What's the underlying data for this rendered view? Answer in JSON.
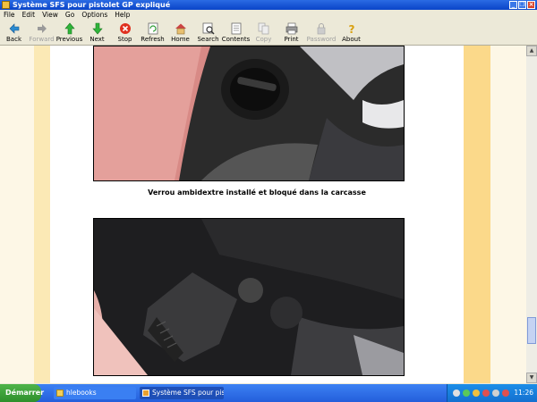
{
  "window": {
    "title": "Système SFS pour pistolet GP expliqué",
    "buttons": [
      "_",
      "❐",
      "×"
    ]
  },
  "menu": [
    "File",
    "Edit",
    "View",
    "Go",
    "Options",
    "Help"
  ],
  "toolbar": [
    {
      "label": "Back",
      "icon": "arrow-left-icon",
      "enabled": true
    },
    {
      "label": "Forward",
      "icon": "arrow-right-icon",
      "enabled": false
    },
    {
      "label": "Previous",
      "icon": "arrow-up-icon",
      "enabled": true
    },
    {
      "label": "Next",
      "icon": "arrow-down-icon",
      "enabled": true
    },
    {
      "label": "Stop",
      "icon": "stop-icon",
      "enabled": true
    },
    {
      "label": "Refresh",
      "icon": "refresh-icon",
      "enabled": true
    },
    {
      "label": "Home",
      "icon": "home-icon",
      "enabled": true
    },
    {
      "label": "Search",
      "icon": "search-icon",
      "enabled": true
    },
    {
      "label": "Contents",
      "icon": "contents-icon",
      "enabled": true
    },
    {
      "label": "Copy",
      "icon": "copy-icon",
      "enabled": false
    },
    {
      "label": "Print",
      "icon": "print-icon",
      "enabled": true
    },
    {
      "label": "Password",
      "icon": "password-icon",
      "enabled": false
    },
    {
      "label": "About",
      "icon": "about-icon",
      "enabled": true
    }
  ],
  "content": {
    "caption": "Verrou ambidextre installé et bloqué dans la carcasse"
  },
  "taskbar": {
    "start_label": "Démarrer",
    "tasks": [
      {
        "label": "hlebooks",
        "icon": "folder-icon",
        "active": false
      },
      {
        "label": "Système SFS pour pis...",
        "icon": "ebook-icon",
        "active": true
      }
    ],
    "clock": "11:26"
  },
  "colors": {
    "titlebar": "#0a44c8",
    "page_bg": "#fdf7e6",
    "stripe_left": "#fbe9b5",
    "stripe_right": "#fbd98a",
    "taskbar": "#245edb",
    "start": "#2e8f2c"
  }
}
